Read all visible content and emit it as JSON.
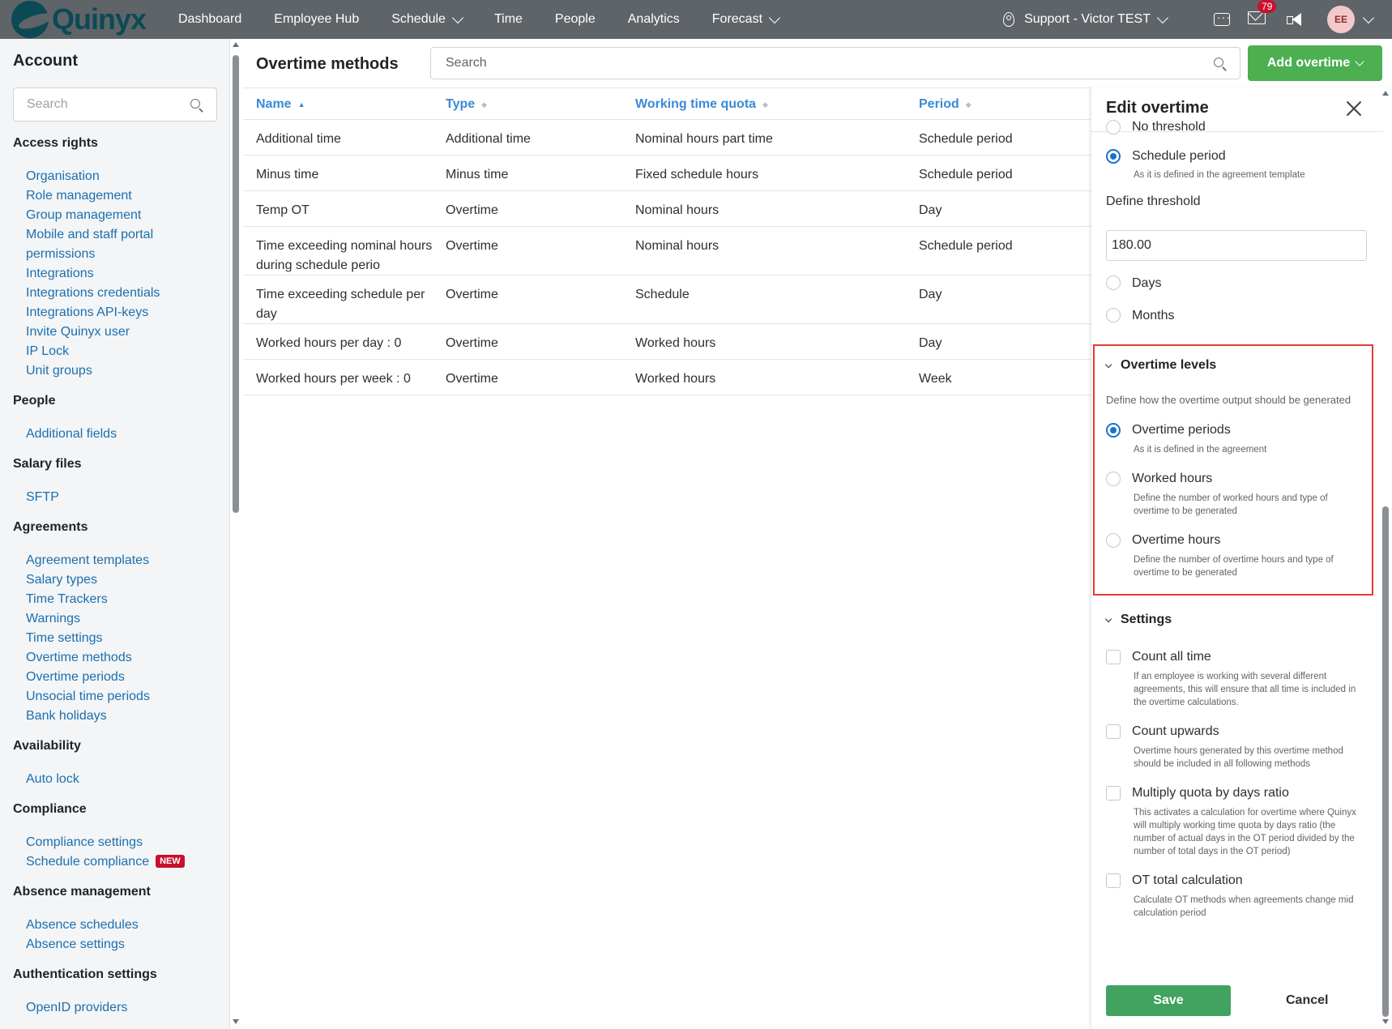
{
  "topbar": {
    "logo_text": "Quinyx",
    "nav": [
      {
        "label": "Dashboard",
        "has_menu": false
      },
      {
        "label": "Employee Hub",
        "has_menu": false
      },
      {
        "label": "Schedule",
        "has_menu": true
      },
      {
        "label": "Time",
        "has_menu": false
      },
      {
        "label": "People",
        "has_menu": false
      },
      {
        "label": "Analytics",
        "has_menu": false
      },
      {
        "label": "Forecast",
        "has_menu": true
      }
    ],
    "support_label": "Support - Victor TEST",
    "notification_count": "79",
    "avatar_initials": "EE",
    "icons": [
      "location-pin-icon",
      "chat-icon",
      "mail-icon",
      "megaphone-icon"
    ]
  },
  "sidebar": {
    "title": "Account",
    "search_placeholder": "Search",
    "sections": [
      {
        "title": "Access rights",
        "links": [
          "Organisation",
          "Role management",
          "Group management",
          "Mobile and staff portal",
          "permissions",
          "Integrations",
          "Integrations credentials",
          "Integrations API-keys",
          "Invite Quinyx user",
          "IP Lock",
          "Unit groups"
        ]
      },
      {
        "title": "People",
        "links": [
          "Additional fields"
        ]
      },
      {
        "title": "Salary files",
        "links": [
          "SFTP"
        ]
      },
      {
        "title": "Agreements",
        "links": [
          "Agreement templates",
          "Salary types",
          "Time Trackers",
          "Warnings",
          "Time settings",
          "Overtime methods",
          "Overtime periods",
          "Unsocial time periods",
          "Bank holidays"
        ]
      },
      {
        "title": "Availability",
        "links": [
          "Auto lock"
        ]
      },
      {
        "title": "Compliance",
        "links": [
          "Compliance settings",
          "Schedule compliance"
        ]
      },
      {
        "title": "Absence management",
        "links": [
          "Absence schedules",
          "Absence settings"
        ]
      },
      {
        "title": "Authentication settings",
        "links": [
          "OpenID providers"
        ]
      }
    ],
    "new_badge": "NEW"
  },
  "main": {
    "title": "Overtime methods",
    "search_placeholder": "Search",
    "add_button": "Add overtime",
    "columns": [
      "Name",
      "Type",
      "Working time quota",
      "Period"
    ],
    "rows": [
      [
        "Additional time",
        "Additional time",
        "Nominal hours part time",
        "Schedule period"
      ],
      [
        "Minus time",
        "Minus time",
        "Fixed schedule hours",
        "Schedule period"
      ],
      [
        "Temp OT",
        "Overtime",
        "Nominal hours",
        "Day"
      ],
      [
        "Time exceeding nominal hours during schedule perio",
        "Overtime",
        "Nominal hours",
        "Schedule period"
      ],
      [
        "Time exceeding schedule per day",
        "Overtime",
        "Schedule",
        "Day"
      ],
      [
        "Worked hours per day : 0",
        "Overtime",
        "Worked hours",
        "Day"
      ],
      [
        "Worked hours per week : 0",
        "Overtime",
        "Worked hours",
        "Week"
      ]
    ]
  },
  "panel": {
    "title": "Edit overtime",
    "threshold_options": [
      {
        "label": "No threshold",
        "help": "",
        "selected": false
      },
      {
        "label": "Schedule period",
        "help": "As it is defined in the agreement template",
        "selected": true
      }
    ],
    "define_threshold_label": "Define threshold",
    "threshold_value": "180.00",
    "unit_options": [
      {
        "label": "Days",
        "selected": false
      },
      {
        "label": "Months",
        "selected": false
      }
    ],
    "overtime_levels": {
      "title": "Overtime levels",
      "description": "Define how the overtime output should be generated",
      "options": [
        {
          "label": "Overtime periods",
          "help": "As it is defined in the agreement",
          "selected": true
        },
        {
          "label": "Worked hours",
          "help": "Define the number of worked hours and type of overtime to be generated",
          "selected": false
        },
        {
          "label": "Overtime hours",
          "help": "Define the number of overtime hours and type of overtime to be generated",
          "selected": false
        }
      ]
    },
    "settings": {
      "title": "Settings",
      "options": [
        {
          "label": "Count all time",
          "help": "If an employee is working with several different agreements, this will ensure that all time is included in the overtime calculations.",
          "checked": false
        },
        {
          "label": "Count upwards",
          "help": "Overtime hours generated by this overtime method should be included in all following methods",
          "checked": false
        },
        {
          "label": "Multiply quota by days ratio",
          "help": "This activates a calculation for overtime where Quinyx will multiply working time quota by days ratio (the number of actual days in the OT period divided by the number of total days in the OT period)",
          "checked": false
        },
        {
          "label": "OT total calculation",
          "help": "Calculate OT methods when agreements change mid calculation period",
          "checked": false
        }
      ]
    },
    "save_label": "Save",
    "cancel_label": "Cancel"
  },
  "colors": {
    "topbar": "#5f6469",
    "link": "#1a6fb0",
    "primary_green": "#4caf50",
    "save_green": "#41a35f",
    "radio_blue": "#1a73c8",
    "highlight_red": "#e53935",
    "badge_red": "#c8102e"
  }
}
